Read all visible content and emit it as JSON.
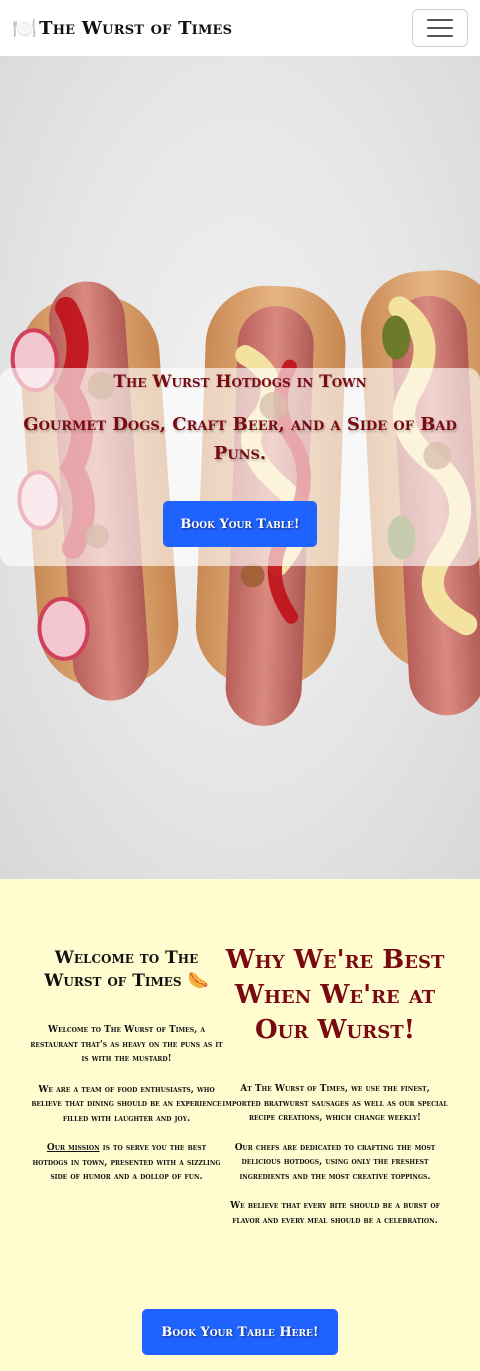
{
  "navbar": {
    "brand_icon": "🍽️",
    "brand_text": "The Wurst of Times",
    "toggler_icon": "hamburger-menu-icon"
  },
  "hero": {
    "image_subject": "three gourmet hotdogs with toppings",
    "title": "The Wurst Hotdogs in Town",
    "subtitle": "Gourmet Dogs, Craft Beer, and a Side of Bad Puns.",
    "button_label": "Book Your Table!"
  },
  "about": {
    "welcome_heading": "Welcome to The Wurst of Times",
    "welcome_heading_icon": "🌭",
    "left_paragraphs": {
      "p1": "Welcome to The Wurst of Times, a restaurant that's as heavy on the puns as it is with the mustard!",
      "p2": "We are a team of food enthusiasts, who believe that dining should be an experience filled with laughter and joy.",
      "p3_link": "Our mission",
      "p3_rest": " is to serve you the best hotdogs in town, presented with a sizzling side of humor and a dollop of fun."
    },
    "why_heading": "Why We're Best When We're at Our Wurst!",
    "right_paragraphs": {
      "p1": "At The Wurst of Times, we use the finest, imported bratwurst sausages as well as our special recipe creations, which change weekly!",
      "p2": "Our chefs are dedicated to crafting the most delicious hotdogs, using only the freshest ingredients and the most creative toppings.",
      "p3": "We believe that every bite should be a burst of flavor and every meal should be a celebration."
    },
    "button_label": "Book Your Table Here!"
  },
  "colors": {
    "accent_red": "#7a0a12",
    "button_blue": "#1f63ff",
    "section_bg": "#fffdd0"
  }
}
